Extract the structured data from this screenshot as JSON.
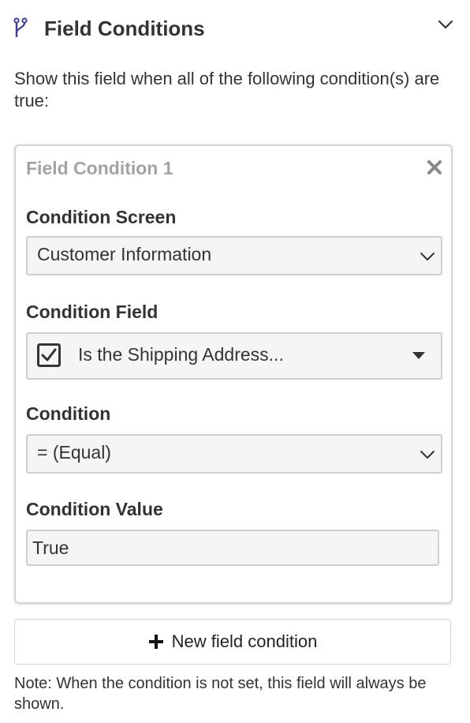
{
  "panel": {
    "title": "Field Conditions",
    "description": "Show this field when all of the following condition(s) are true:",
    "accent_color": "#3b3f8f"
  },
  "condition_card": {
    "title": "Field Condition 1",
    "screen": {
      "label": "Condition Screen",
      "value": "Customer Information"
    },
    "field": {
      "label": "Condition Field",
      "value": "Is the Shipping Address...",
      "icon": "checkbox-checked-icon"
    },
    "condition": {
      "label": "Condition",
      "value": "= (Equal)"
    },
    "value": {
      "label": "Condition Value",
      "value": "True"
    }
  },
  "add_button": {
    "label": "New field condition"
  },
  "note": "Note: When the condition is not set, this field will always be shown."
}
